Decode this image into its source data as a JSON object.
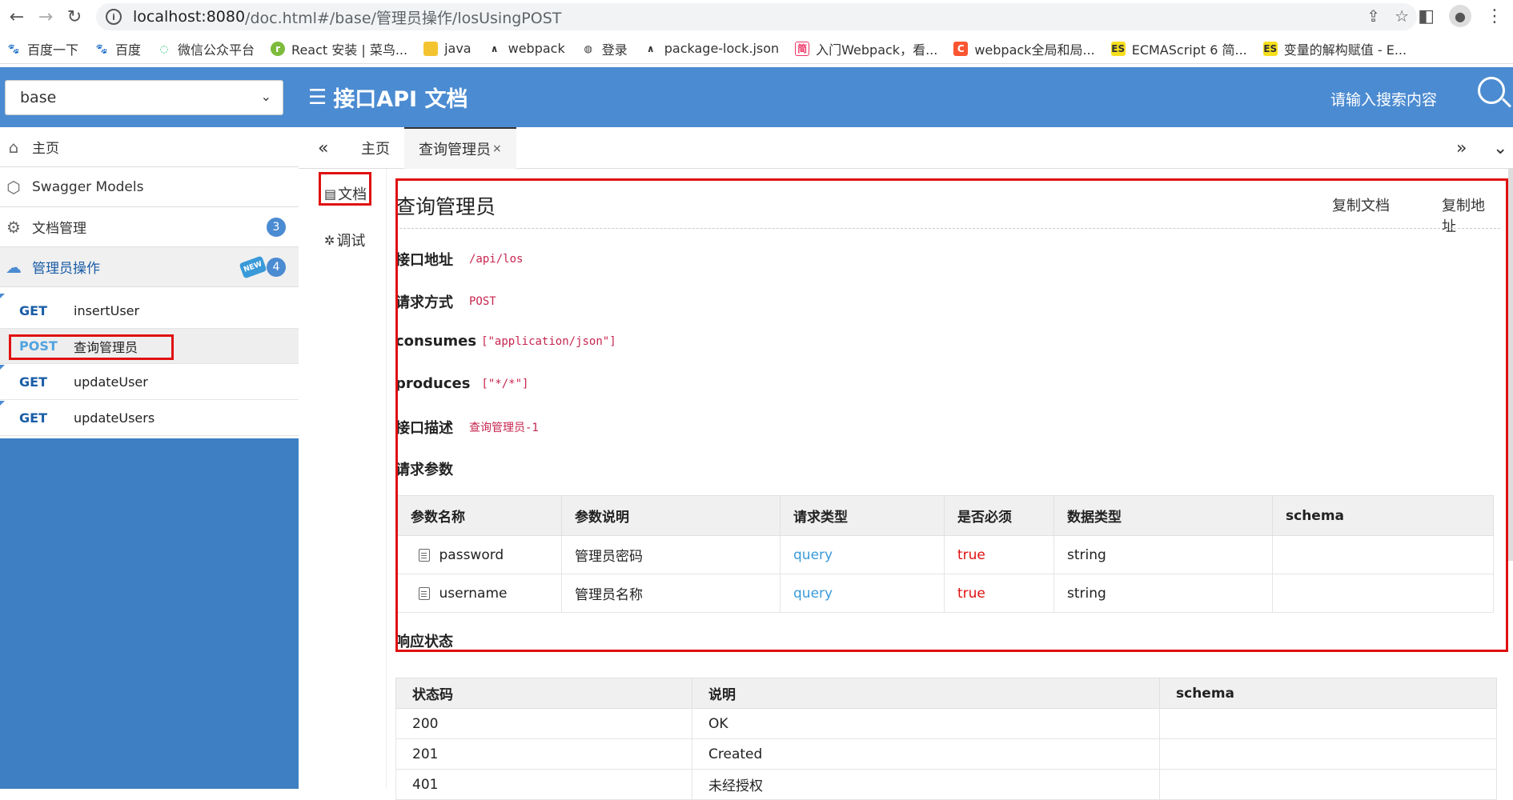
{
  "browser": {
    "url_host": "localhost:8080",
    "url_path": "/doc.html#/base/管理员操作/losUsingPOST"
  },
  "bookmarks": [
    {
      "label": "百度一下",
      "icon": "baidu-paw-icon"
    },
    {
      "label": "百度",
      "icon": "baidu-paw-icon"
    },
    {
      "label": "微信公众平台",
      "icon": "wechat-icon"
    },
    {
      "label": "React 安装 | 菜鸟...",
      "icon": "runoob-icon"
    },
    {
      "label": "java",
      "icon": "folder-icon"
    },
    {
      "label": "webpack",
      "icon": "vercel-icon"
    },
    {
      "label": "登录",
      "icon": "globe-icon"
    },
    {
      "label": "package-lock.json",
      "icon": "vercel-icon"
    },
    {
      "label": "入门Webpack，看...",
      "icon": "jianshu-icon"
    },
    {
      "label": "webpack全局和局...",
      "icon": "csdn-icon"
    },
    {
      "label": "ECMAScript 6 简...",
      "icon": "es-icon"
    },
    {
      "label": "变量的解构赋值 - E...",
      "icon": "es-icon"
    }
  ],
  "header": {
    "group_select": "base",
    "title": "接口API 文档",
    "search_placeholder": "请输入搜索内容"
  },
  "sidebar": {
    "home": "主页",
    "models": "Swagger Models",
    "doc_manage": "文档管理",
    "doc_manage_count": "3",
    "admin_ops": "管理员操作",
    "admin_ops_new": "NEW",
    "admin_ops_count": "4",
    "apis": [
      {
        "method": "GET",
        "name": "insertUser"
      },
      {
        "method": "POST",
        "name": "查询管理员"
      },
      {
        "method": "GET",
        "name": "updateUser"
      },
      {
        "method": "GET",
        "name": "updateUsers"
      }
    ]
  },
  "tabs": {
    "home": "主页",
    "active": "查询管理员",
    "close": "×"
  },
  "leftnav": {
    "doc": "文档",
    "debug": "调试"
  },
  "doc": {
    "title": "查询管理员",
    "copy_doc": "复制文档",
    "copy_addr": "复制地址",
    "address_label": "接口地址",
    "address": "/api/los",
    "method_label": "请求方式",
    "method": "POST",
    "consumes_label": "consumes",
    "consumes": "[\"application/json\"]",
    "produces_label": "produces",
    "produces": "[\"*/*\"]",
    "desc_label": "接口描述",
    "desc": "查询管理员-1",
    "params_label": "请求参数",
    "param_headers": [
      "参数名称",
      "参数说明",
      "请求类型",
      "是否必须",
      "数据类型",
      "schema"
    ],
    "params": [
      {
        "name": "password",
        "desc": "管理员密码",
        "in": "query",
        "required": "true",
        "type": "string",
        "schema": ""
      },
      {
        "name": "username",
        "desc": "管理员名称",
        "in": "query",
        "required": "true",
        "type": "string",
        "schema": ""
      }
    ],
    "response_label": "响应状态",
    "status_headers": [
      "状态码",
      "说明",
      "schema"
    ],
    "statuses": [
      {
        "code": "200",
        "desc": "OK",
        "schema": ""
      },
      {
        "code": "201",
        "desc": "Created",
        "schema": ""
      },
      {
        "code": "401",
        "desc": "未经授权",
        "schema": ""
      }
    ]
  }
}
